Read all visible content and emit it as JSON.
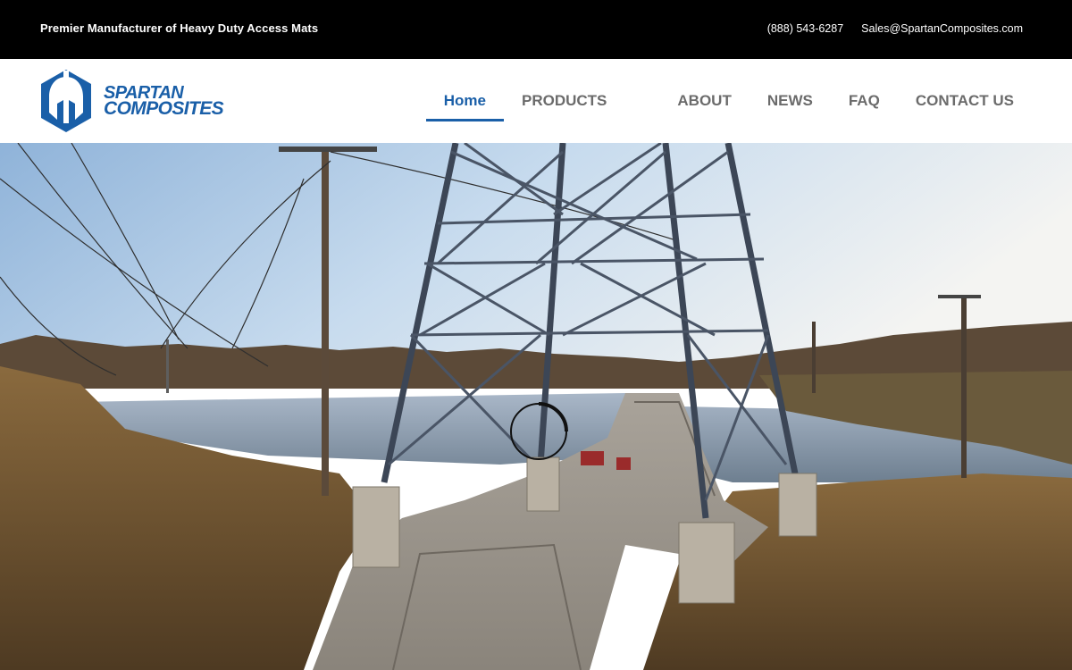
{
  "topbar": {
    "tagline": "Premier Manufacturer of Heavy Duty Access Mats",
    "phone": "(888) 543-6287",
    "email": "Sales@SpartanComposites.com"
  },
  "logo": {
    "line1": "SPARTAN",
    "line2": "COMPOSITES",
    "icon": "spartan-helmet-icon"
  },
  "nav": {
    "items": [
      {
        "label": "Home",
        "active": true
      },
      {
        "label": "PRODUCTS"
      },
      {
        "label": "ABOUT"
      },
      {
        "label": "NEWS"
      },
      {
        "label": "FAQ"
      },
      {
        "label": "CONTACT US"
      }
    ]
  },
  "hero": {
    "icon": "loading-spinner-icon"
  },
  "colors": {
    "brand": "#1a5fa8",
    "topbar": "#000000",
    "nav_text": "#6b6b6b"
  }
}
